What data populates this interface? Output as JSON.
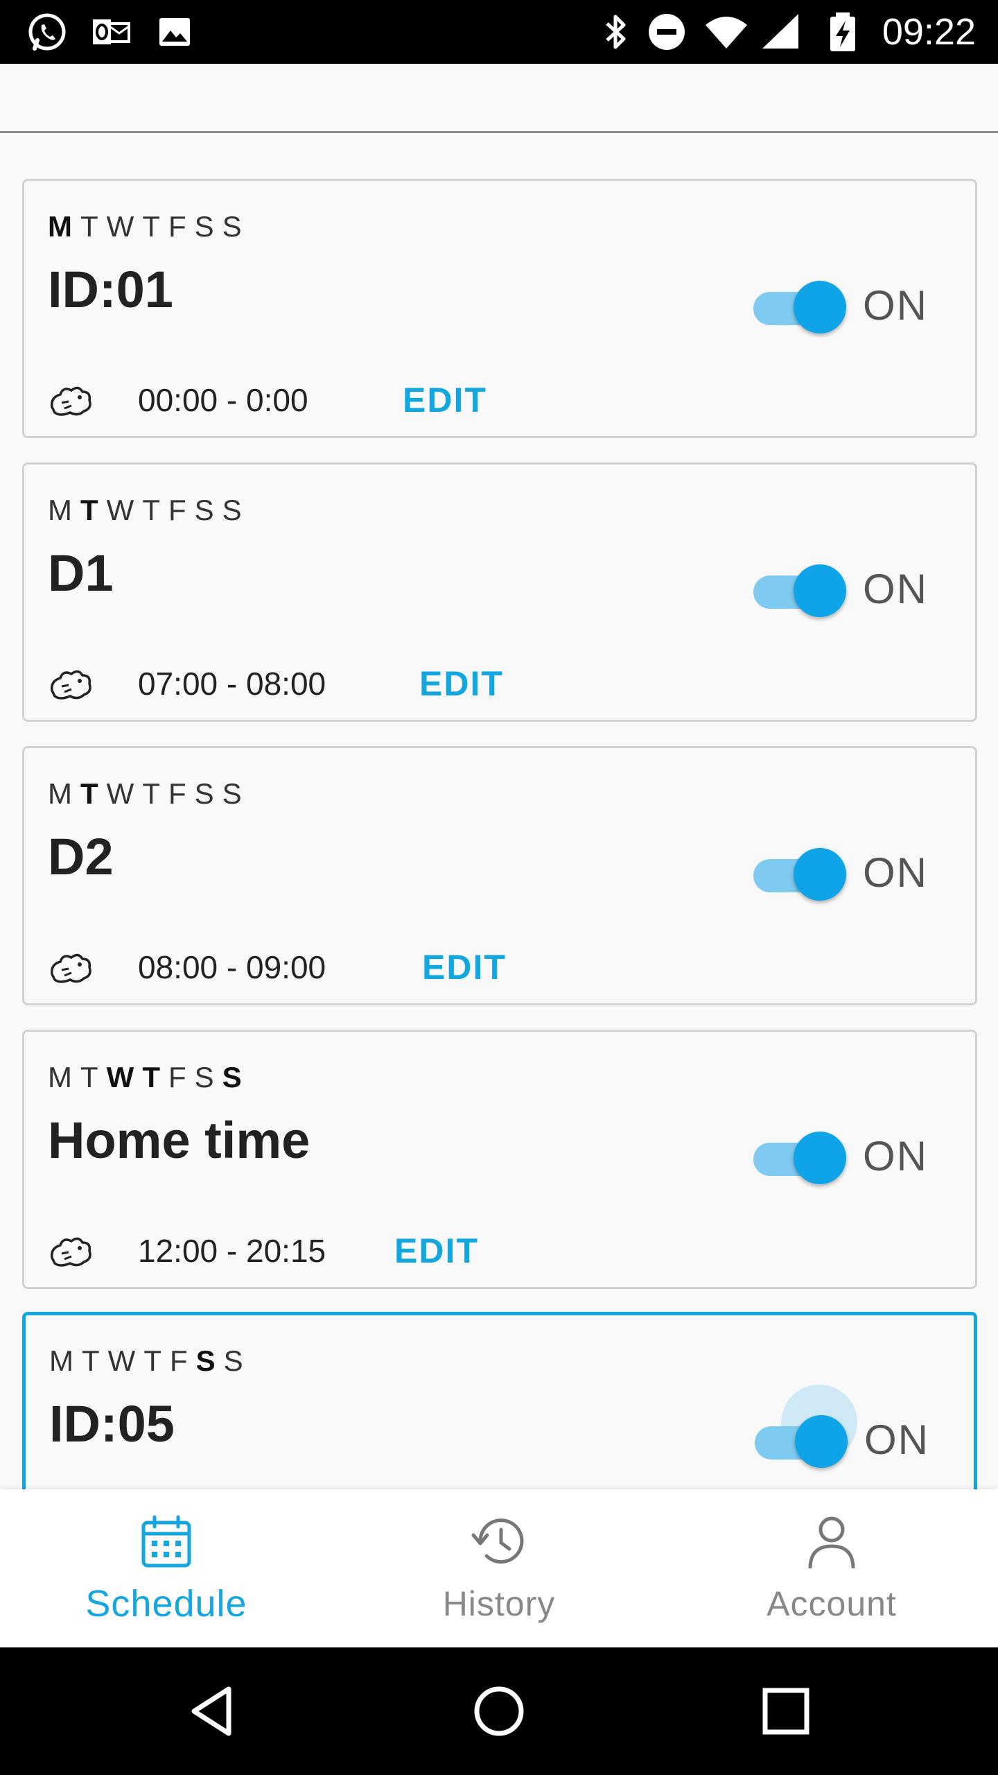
{
  "status_bar": {
    "time": "09:22",
    "left_icons": [
      "whatsapp-icon",
      "outlook-icon",
      "gallery-icon"
    ],
    "right_icons": [
      "bluetooth-icon",
      "do-not-disturb-icon",
      "wifi-icon",
      "signal-icon",
      "battery-charging-icon"
    ]
  },
  "day_letters": [
    "M",
    "T",
    "W",
    "T",
    "F",
    "S",
    "S"
  ],
  "schedules": [
    {
      "title": "ID:01",
      "bold_days": [
        0
      ],
      "time_range": "00:00 - 0:00",
      "toggle_label": "ON",
      "enabled": true,
      "edit_label": "EDIT"
    },
    {
      "title": "D1",
      "bold_days": [
        1
      ],
      "time_range": "07:00 - 08:00",
      "toggle_label": "ON",
      "enabled": true,
      "edit_label": "EDIT"
    },
    {
      "title": "D2",
      "bold_days": [
        1
      ],
      "time_range": "08:00 - 09:00",
      "toggle_label": "ON",
      "enabled": true,
      "edit_label": "EDIT"
    },
    {
      "title": "Home time",
      "bold_days": [
        2,
        3,
        6
      ],
      "time_range": "12:00 - 20:15",
      "toggle_label": "ON",
      "enabled": true,
      "edit_label": "EDIT"
    },
    {
      "title": "ID:05",
      "bold_days": [
        5
      ],
      "time_range": "",
      "toggle_label": "ON",
      "enabled": true,
      "edit_label": ""
    }
  ],
  "bottom_nav": {
    "items": [
      {
        "label": "Schedule",
        "icon": "calendar-icon",
        "selected": true
      },
      {
        "label": "History",
        "icon": "history-icon",
        "selected": false
      },
      {
        "label": "Account",
        "icon": "person-icon",
        "selected": false
      }
    ]
  },
  "system_nav": {
    "buttons": [
      "back-icon",
      "home-icon",
      "recents-icon"
    ]
  },
  "colors": {
    "accent": "#13a6df",
    "toggle_thumb": "#0fa4e8",
    "toggle_track": "#7fcaf0"
  }
}
